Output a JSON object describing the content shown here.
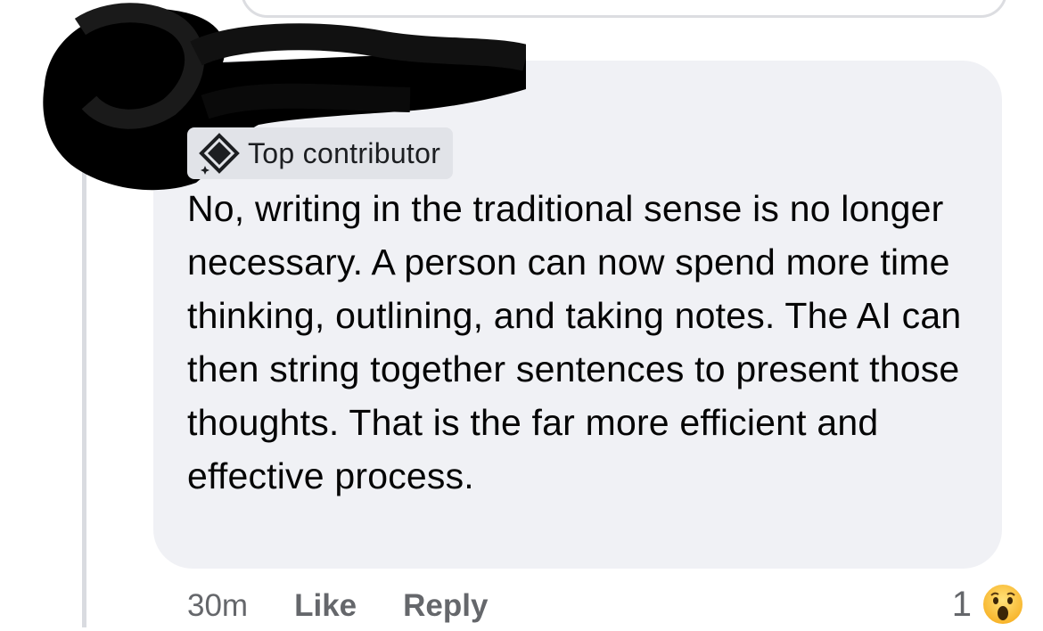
{
  "comment": {
    "badge_label": "Top contributor",
    "badge_icon": "diamond-sparkle-icon",
    "text": "No, writing in the traditional sense is no longer necessary. A person can now spend more time thinking, outlining, and taking notes. The AI can then string together sentences to present those thoughts. That is the far more efficient and effective process.",
    "timestamp": "30m",
    "like_label": "Like",
    "reply_label": "Reply",
    "reaction_count": "1",
    "reaction_icon": "wow-emoji-icon"
  },
  "colors": {
    "bubble_background": "#f0f1f5",
    "badge_background": "#e1e3e8",
    "action_text": "#65676b",
    "body_text": "#050505"
  }
}
